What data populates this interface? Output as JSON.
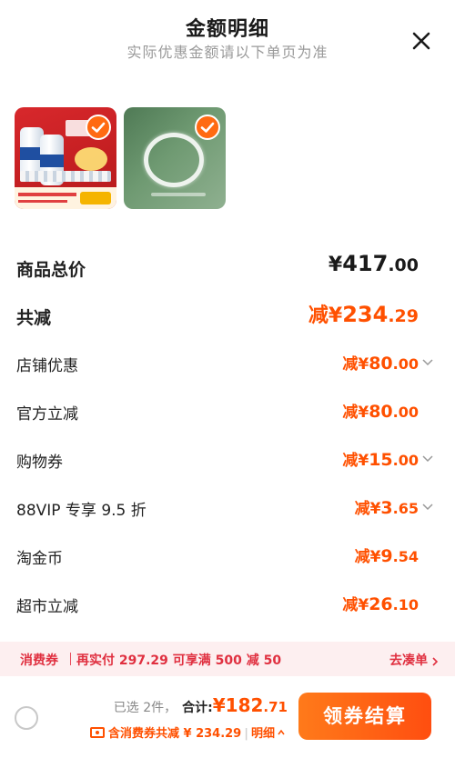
{
  "header": {
    "title": "金额明细",
    "subtitle": "实际优惠金额请以下单页为准"
  },
  "icons": {
    "close": "close-icon",
    "check": "check-icon",
    "chevron": "chevron-down-icon",
    "coupon": "coupon-icon"
  },
  "colors": {
    "accent": "#ff5000",
    "coupon_bar_bg": "#fdeff0",
    "coupon_text": "#e03040"
  },
  "products": [
    {
      "name": "beer-product-thumbnail",
      "selected": true
    },
    {
      "name": "ring-product-thumbnail",
      "selected": true
    }
  ],
  "rows": [
    {
      "label": "商品总价",
      "prefix": "",
      "currency": "¥",
      "integer": "417",
      "decimal": ".00",
      "expandable": false
    },
    {
      "label": "共减",
      "prefix": "减",
      "currency": "¥",
      "integer": "234",
      "decimal": ".29",
      "expandable": false
    },
    {
      "label": "店铺优惠",
      "prefix": "减",
      "currency": "¥",
      "integer": "80",
      "decimal": ".00",
      "expandable": true
    },
    {
      "label": "官方立减",
      "prefix": "减",
      "currency": "¥",
      "integer": "80",
      "decimal": ".00",
      "expandable": false
    },
    {
      "label": "购物券",
      "prefix": "减",
      "currency": "¥",
      "integer": "15",
      "decimal": ".00",
      "expandable": true
    },
    {
      "label": "88VIP 专享 9.5 折",
      "prefix": "减",
      "currency": "¥",
      "integer": "3",
      "decimal": ".65",
      "expandable": true
    },
    {
      "label": "淘金币",
      "prefix": "减",
      "currency": "¥",
      "integer": "9",
      "decimal": ".54",
      "expandable": false
    },
    {
      "label": "超市立减",
      "prefix": "减",
      "currency": "¥",
      "integer": "26",
      "decimal": ".10",
      "expandable": false
    }
  ],
  "coupon_bar": {
    "label": "消费券",
    "desc": "再实付 297.29 可享满 500 减 50",
    "link": "去凑单"
  },
  "footer": {
    "selected": "已选 2件，",
    "total_label": "合计:",
    "total_currency": "¥",
    "total_integer": "182",
    "total_decimal": ".71",
    "discount_text": "含消费券共减 ¥ 234.29",
    "detail_link": "明细",
    "checkout_label": "领券结算"
  }
}
